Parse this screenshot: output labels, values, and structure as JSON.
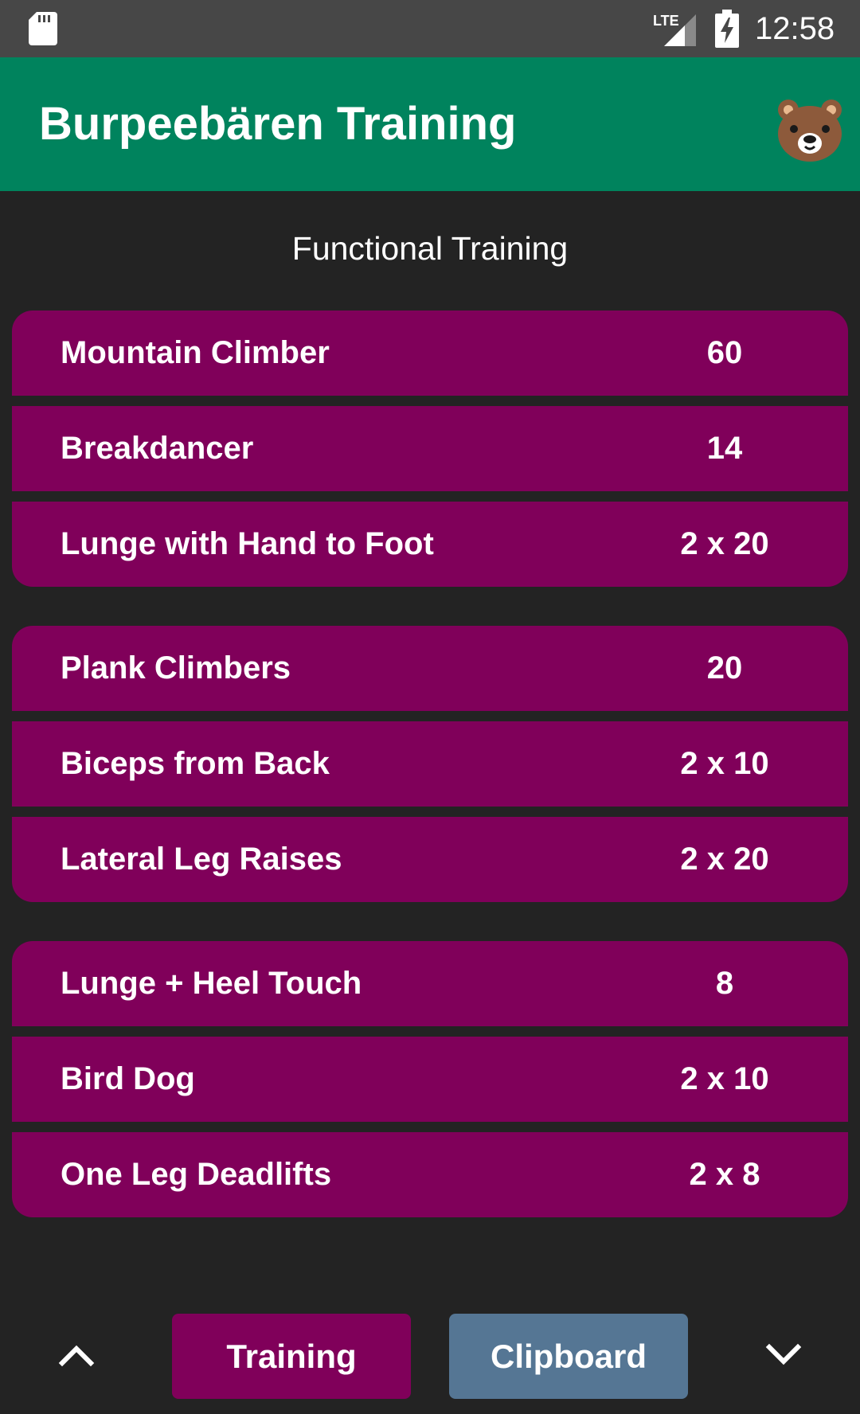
{
  "status_bar": {
    "time": "12:58",
    "network_label": "LTE"
  },
  "app_bar": {
    "title": "Burpeebären Training",
    "logo_icon": "bear-face-icon"
  },
  "section_title": "Functional Training",
  "groups": [
    {
      "exercises": [
        {
          "name": "Mountain Climber",
          "reps": "60"
        },
        {
          "name": "Breakdancer",
          "reps": "14"
        },
        {
          "name": "Lunge with Hand to Foot",
          "reps": "2 x 20"
        }
      ]
    },
    {
      "exercises": [
        {
          "name": "Plank Climbers",
          "reps": "20"
        },
        {
          "name": "Biceps from Back",
          "reps": "2 x 10"
        },
        {
          "name": "Lateral Leg Raises",
          "reps": "2 x 20"
        }
      ]
    },
    {
      "exercises": [
        {
          "name": "Lunge + Heel Touch",
          "reps": "8"
        },
        {
          "name": "Bird Dog",
          "reps": "2 x 10"
        },
        {
          "name": "One Leg Deadlifts",
          "reps": "2 x 8"
        }
      ]
    }
  ],
  "bottom_bar": {
    "training_label": "Training",
    "clipboard_label": "Clipboard",
    "up_icon": "chevron-up-icon",
    "down_icon": "chevron-down-icon"
  },
  "colors": {
    "background": "#232323",
    "status_bar": "#474747",
    "app_bar": "#00835d",
    "exercise_row": "#80005a",
    "training_button": "#80005a",
    "clipboard_button": "#557694"
  }
}
